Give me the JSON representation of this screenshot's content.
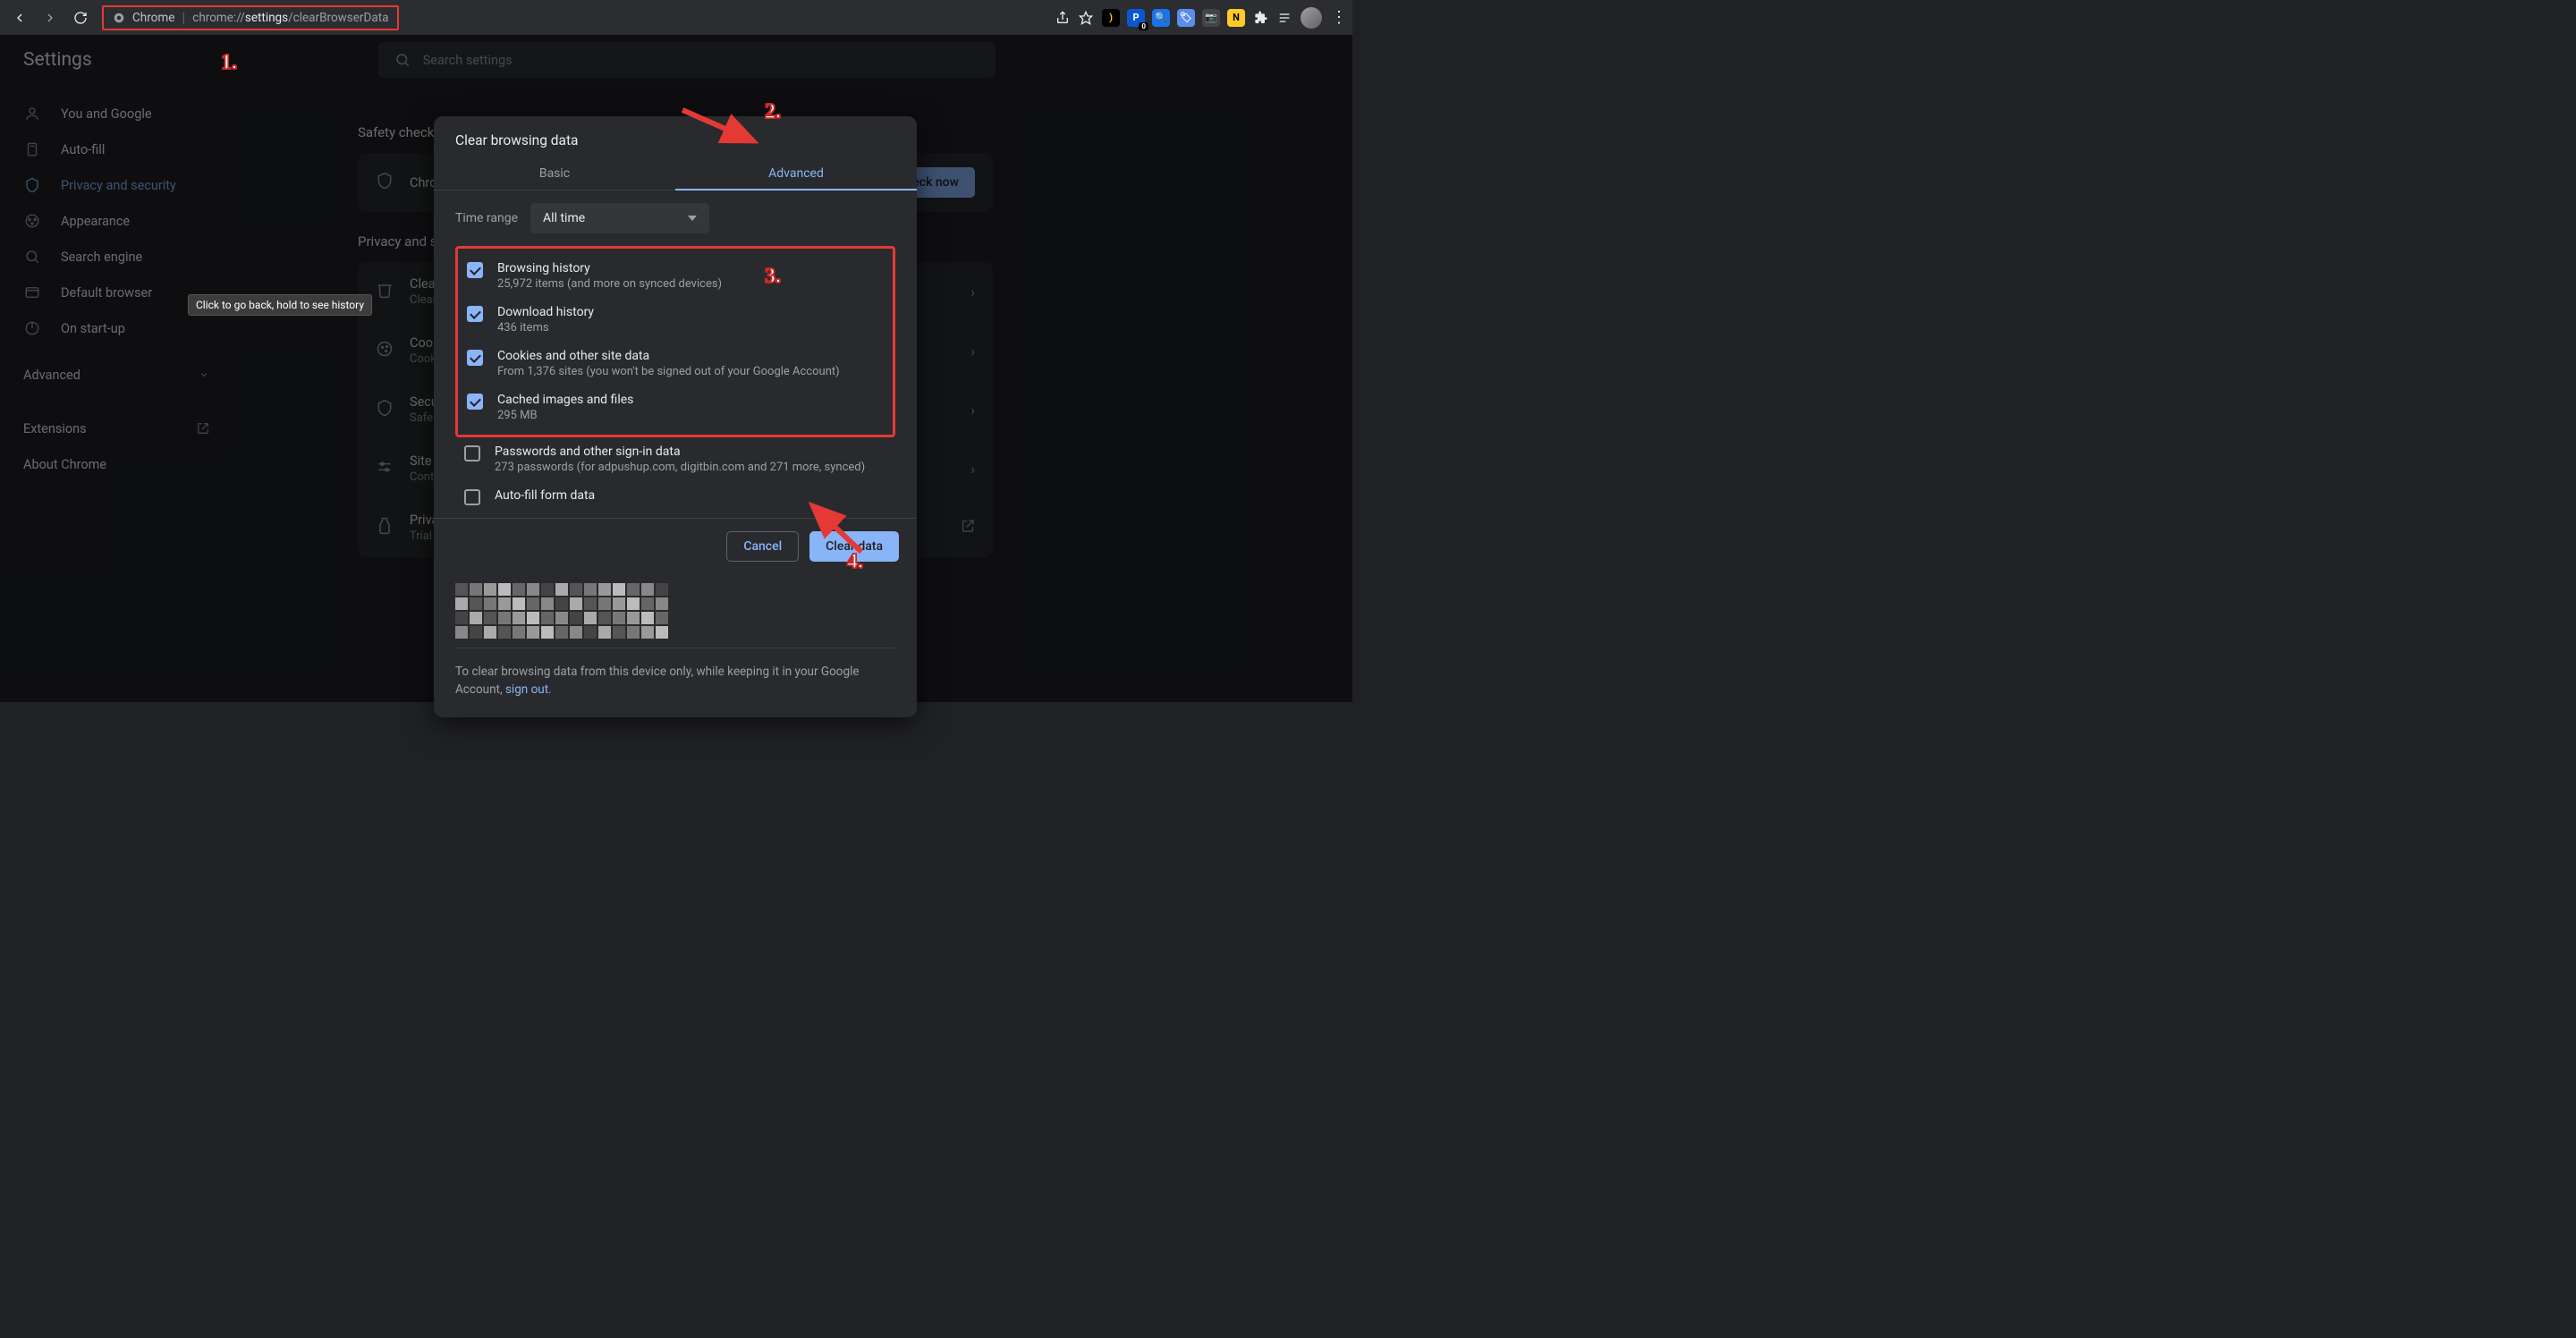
{
  "browser": {
    "label": "Chrome",
    "url_plain_pre": "chrome://",
    "url_bold": "settings",
    "url_plain_post": "/clearBrowserData"
  },
  "extensions_bar": [
    {
      "bg": "#000",
      "fg": "#ffcc00",
      "txt": ")"
    },
    {
      "bg": "#0b57d0",
      "fg": "#fff",
      "txt": "P",
      "badge": "0"
    },
    {
      "bg": "#1a73e8",
      "fg": "#fff",
      "txt": "🔍"
    },
    {
      "bg": "#5b8def",
      "fg": "#fff",
      "txt": "🏷"
    },
    {
      "bg": "#444",
      "fg": "#ddd",
      "txt": "📷"
    },
    {
      "bg": "#ffca28",
      "fg": "#000",
      "txt": "N"
    }
  ],
  "page": {
    "title": "Settings",
    "search_placeholder": "Search settings"
  },
  "sidebar": {
    "items": [
      {
        "label": "You and Google"
      },
      {
        "label": "Auto-fill"
      },
      {
        "label": "Privacy and security"
      },
      {
        "label": "Appearance"
      },
      {
        "label": "Search engine"
      },
      {
        "label": "Default browser"
      },
      {
        "label": "On start-up"
      }
    ],
    "advanced": "Advanced",
    "extensions": "Extensions",
    "about": "About Chrome"
  },
  "tooltip": "Click to go back, hold to see history",
  "main": {
    "safety_heading": "Safety check",
    "safety_row": "Chrome can help keep you safe from data breaches, bad extensions and more",
    "check_btn": "Check now",
    "privacy_heading": "Privacy and security",
    "rows": [
      {
        "t1": "Clear browsing data",
        "t2": "Clear history, cookies, cache and more"
      },
      {
        "t1": "Cookies and other site data",
        "t2": "Cookies are allowed"
      },
      {
        "t1": "Security",
        "t2": "Safe Browsing (protection from dangerous sites) and other security settings"
      },
      {
        "t1": "Site settings",
        "t2": "Controls what information sites can use and show"
      },
      {
        "t1": "Privacy Sandbox",
        "t2": "Trial features are on"
      }
    ]
  },
  "dialog": {
    "title": "Clear browsing data",
    "tabs": {
      "basic": "Basic",
      "advanced": "Advanced"
    },
    "time_label": "Time range",
    "time_value": "All time",
    "options": [
      {
        "checked": true,
        "t1": "Browsing history",
        "t2": "25,972 items (and more on synced devices)"
      },
      {
        "checked": true,
        "t1": "Download history",
        "t2": "436 items"
      },
      {
        "checked": true,
        "t1": "Cookies and other site data",
        "t2": "From 1,376 sites (you won't be signed out of your Google Account)"
      },
      {
        "checked": true,
        "t1": "Cached images and files",
        "t2": "295 MB"
      }
    ],
    "below_options": [
      {
        "checked": false,
        "t1": "Passwords and other sign-in data",
        "t2": "273 passwords (for adpushup.com, digitbin.com and 271 more, synced)"
      },
      {
        "checked": false,
        "t1": "Auto-fill form data",
        "t2": ""
      }
    ],
    "cancel": "Cancel",
    "clear": "Clear data",
    "footer_pre": "To clear browsing data from this device only, while keeping it in your Google Account, ",
    "footer_link": "sign out",
    "footer_post": "."
  },
  "callouts": {
    "c1": "1.",
    "c2": "2.",
    "c3": "3.",
    "c4": "4."
  }
}
